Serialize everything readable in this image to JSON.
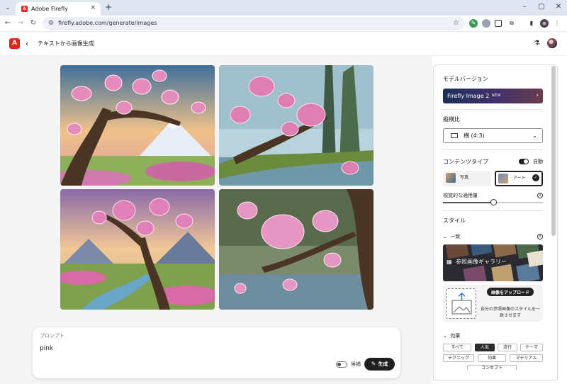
{
  "browser": {
    "tab_title": "Adobe Firefly",
    "url": "firefly.adobe.com/generate/images"
  },
  "app": {
    "logo_letter": "A",
    "page_title": "テキストから画像生成"
  },
  "prompt": {
    "label": "プロンプト",
    "value": "pink",
    "suggest_label": "候補",
    "generate_label": "生成"
  },
  "panel": {
    "model": {
      "title": "モデルバージョン",
      "name": "Firefly Image 2",
      "badge": "NEW"
    },
    "aspect": {
      "title": "縦横比",
      "value": "横 (4:3)"
    },
    "content_type": {
      "title": "コンテンツタイプ",
      "auto_label": "自動",
      "auto_on": true,
      "options": [
        {
          "label": "写真",
          "selected": false
        },
        {
          "label": "アート",
          "selected": true
        }
      ]
    },
    "visual": {
      "label": "視覚的な適用量",
      "level": 0.5
    },
    "style": {
      "title": "スタイル",
      "match_heading": "一致",
      "gallery_label": "参照画像ギャラリー",
      "upload_button": "画像をアップロード",
      "upload_description": "自分の参照画像のスタイルを一致させます"
    },
    "effects": {
      "heading": "効果",
      "chips": [
        "すべて",
        "人気",
        "流行",
        "テーマ",
        "テクニック",
        "効果",
        "マテリアル"
      ],
      "active": "人気",
      "partial": "コンセプト"
    }
  },
  "colors": {
    "brand": "#e1251b",
    "dark_button": "#1f1f1f"
  }
}
